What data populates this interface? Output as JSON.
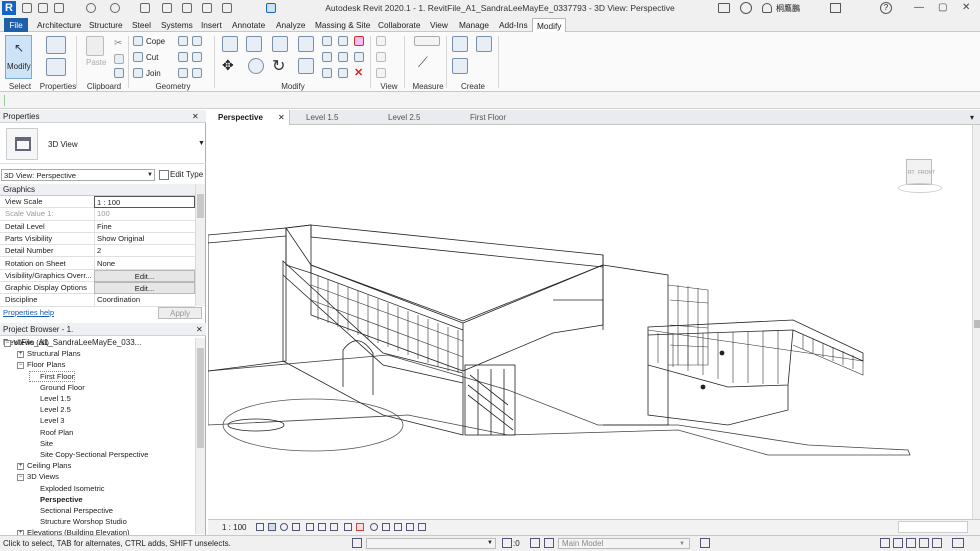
{
  "title_bar": {
    "app_logo": "R",
    "title": "Autodesk Revit 2020.1 -  1. RevitFile_A1_SandraLeeMayEe_0337793 - 3D View: Perspective",
    "user": "桐鷹鵬"
  },
  "ribbon_tabs": [
    "File",
    "Architecture",
    "Structure",
    "Steel",
    "Systems",
    "Insert",
    "Annotate",
    "Analyze",
    "Massing & Site",
    "Collaborate",
    "View",
    "Manage",
    "Add-Ins",
    "Modify"
  ],
  "ribbon": {
    "modify_label": "Modify",
    "paste_label": "Paste",
    "cope_label": "Cope",
    "cut_label": "Cut",
    "join_label": "Join",
    "panels": [
      "Select",
      "Properties",
      "Clipboard",
      "Geometry",
      "Modify",
      "View",
      "Measure",
      "Create"
    ]
  },
  "properties": {
    "header": "Properties",
    "type_name": "3D View",
    "selector": "3D View: Perspective",
    "edit_type": "Edit Type",
    "section": "Graphics",
    "rows": [
      {
        "key": "View Scale",
        "value": "1 : 100"
      },
      {
        "key": "Scale Value    1:",
        "value": "100"
      },
      {
        "key": "Detail Level",
        "value": "Fine"
      },
      {
        "key": "Parts Visibility",
        "value": "Show Original"
      },
      {
        "key": "Detail Number",
        "value": "2"
      },
      {
        "key": "Rotation on Sheet",
        "value": "None"
      },
      {
        "key": "Visibility/Graphics Overr...",
        "value": "Edit..."
      },
      {
        "key": "Graphic Display Options",
        "value": "Edit..."
      },
      {
        "key": "Discipline",
        "value": "Coordination"
      }
    ],
    "help_link": "Properties help",
    "apply": "Apply"
  },
  "project_browser": {
    "header": "Project Browser - 1. RevitFile_A1_SandraLeeMayEe_033...",
    "items": [
      {
        "label": "Views (all)",
        "level": 0,
        "toggle": "−"
      },
      {
        "label": "Structural Plans",
        "level": 1,
        "toggle": "+"
      },
      {
        "label": "Floor Plans",
        "level": 1,
        "toggle": "−"
      },
      {
        "label": "First Floor",
        "level": 2,
        "toggle": "",
        "selected": true
      },
      {
        "label": "Ground Floor",
        "level": 2,
        "toggle": ""
      },
      {
        "label": "Level 1.5",
        "level": 2,
        "toggle": ""
      },
      {
        "label": "Level 2.5",
        "level": 2,
        "toggle": ""
      },
      {
        "label": "Level 3",
        "level": 2,
        "toggle": ""
      },
      {
        "label": "Roof Plan",
        "level": 2,
        "toggle": ""
      },
      {
        "label": "Site",
        "level": 2,
        "toggle": ""
      },
      {
        "label": "Site Copy-Sectional Perspective",
        "level": 2,
        "toggle": ""
      },
      {
        "label": "Ceiling Plans",
        "level": 1,
        "toggle": "+"
      },
      {
        "label": "3D Views",
        "level": 1,
        "toggle": "−"
      },
      {
        "label": "Exploded Isometric",
        "level": 2,
        "toggle": ""
      },
      {
        "label": "Perspective",
        "level": 2,
        "toggle": "",
        "bold": true
      },
      {
        "label": "Sectional Perspective",
        "level": 2,
        "toggle": ""
      },
      {
        "label": "Structure Worshop Studio",
        "level": 2,
        "toggle": ""
      },
      {
        "label": "Elevations (Building Elevation)",
        "level": 1,
        "toggle": "+"
      }
    ]
  },
  "view_tabs": [
    {
      "label": "Perspective",
      "active": true
    },
    {
      "label": "Level 1.5",
      "active": false
    },
    {
      "label": "Level 2.5",
      "active": false
    },
    {
      "label": "First Floor",
      "active": false
    }
  ],
  "viewcube": {
    "left": "RT",
    "front": "FRONT"
  },
  "view_control": {
    "scale": "1 : 100"
  },
  "status": {
    "hint": "Click to select, TAB for alternates, CTRL adds, SHIFT unselects.",
    "coord": ":0",
    "model": "Main Model"
  },
  "colors": {
    "file_tab": "#1f5fa8",
    "accent": "#1464c8",
    "selection": "#cde3f8"
  }
}
